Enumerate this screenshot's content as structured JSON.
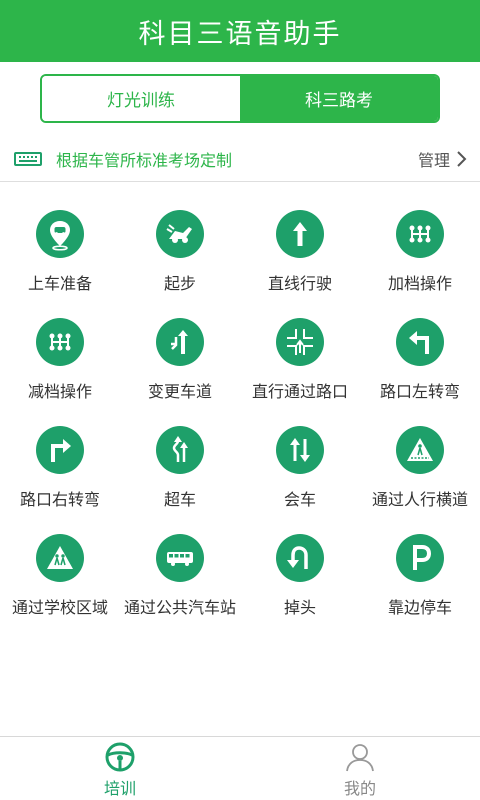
{
  "header": {
    "title": "科目三语音助手"
  },
  "segments": [
    {
      "label": "灯光训练",
      "active": false
    },
    {
      "label": "科三路考",
      "active": true
    }
  ],
  "notice": {
    "text": "根据车管所标准考场定制",
    "action": "管理"
  },
  "items": [
    {
      "label": "上车准备",
      "icon": "location-car-icon"
    },
    {
      "label": "起步",
      "icon": "start-car-icon"
    },
    {
      "label": "直线行驶",
      "icon": "arrow-up-icon"
    },
    {
      "label": "加档操作",
      "icon": "gear-shift-up-icon"
    },
    {
      "label": "减档操作",
      "icon": "gear-shift-down-icon"
    },
    {
      "label": "变更车道",
      "icon": "lane-change-icon"
    },
    {
      "label": "直行通过路口",
      "icon": "intersection-icon"
    },
    {
      "label": "路口左转弯",
      "icon": "turn-left-icon"
    },
    {
      "label": "路口右转弯",
      "icon": "turn-right-icon"
    },
    {
      "label": "超车",
      "icon": "overtake-icon"
    },
    {
      "label": "会车",
      "icon": "two-way-icon"
    },
    {
      "label": "通过人行横道",
      "icon": "pedestrian-crossing-icon"
    },
    {
      "label": "通过学校区域",
      "icon": "school-zone-icon"
    },
    {
      "label": "通过公共汽车站",
      "icon": "bus-icon"
    },
    {
      "label": "掉头",
      "icon": "u-turn-icon"
    },
    {
      "label": "靠边停车",
      "icon": "parking-icon"
    }
  ],
  "tabbar": [
    {
      "label": "培训",
      "icon": "steering-wheel-icon",
      "active": true
    },
    {
      "label": "我的",
      "icon": "user-icon",
      "active": false
    }
  ],
  "colors": {
    "primary": "#2db54a",
    "icon_bg": "#1ea06a"
  }
}
